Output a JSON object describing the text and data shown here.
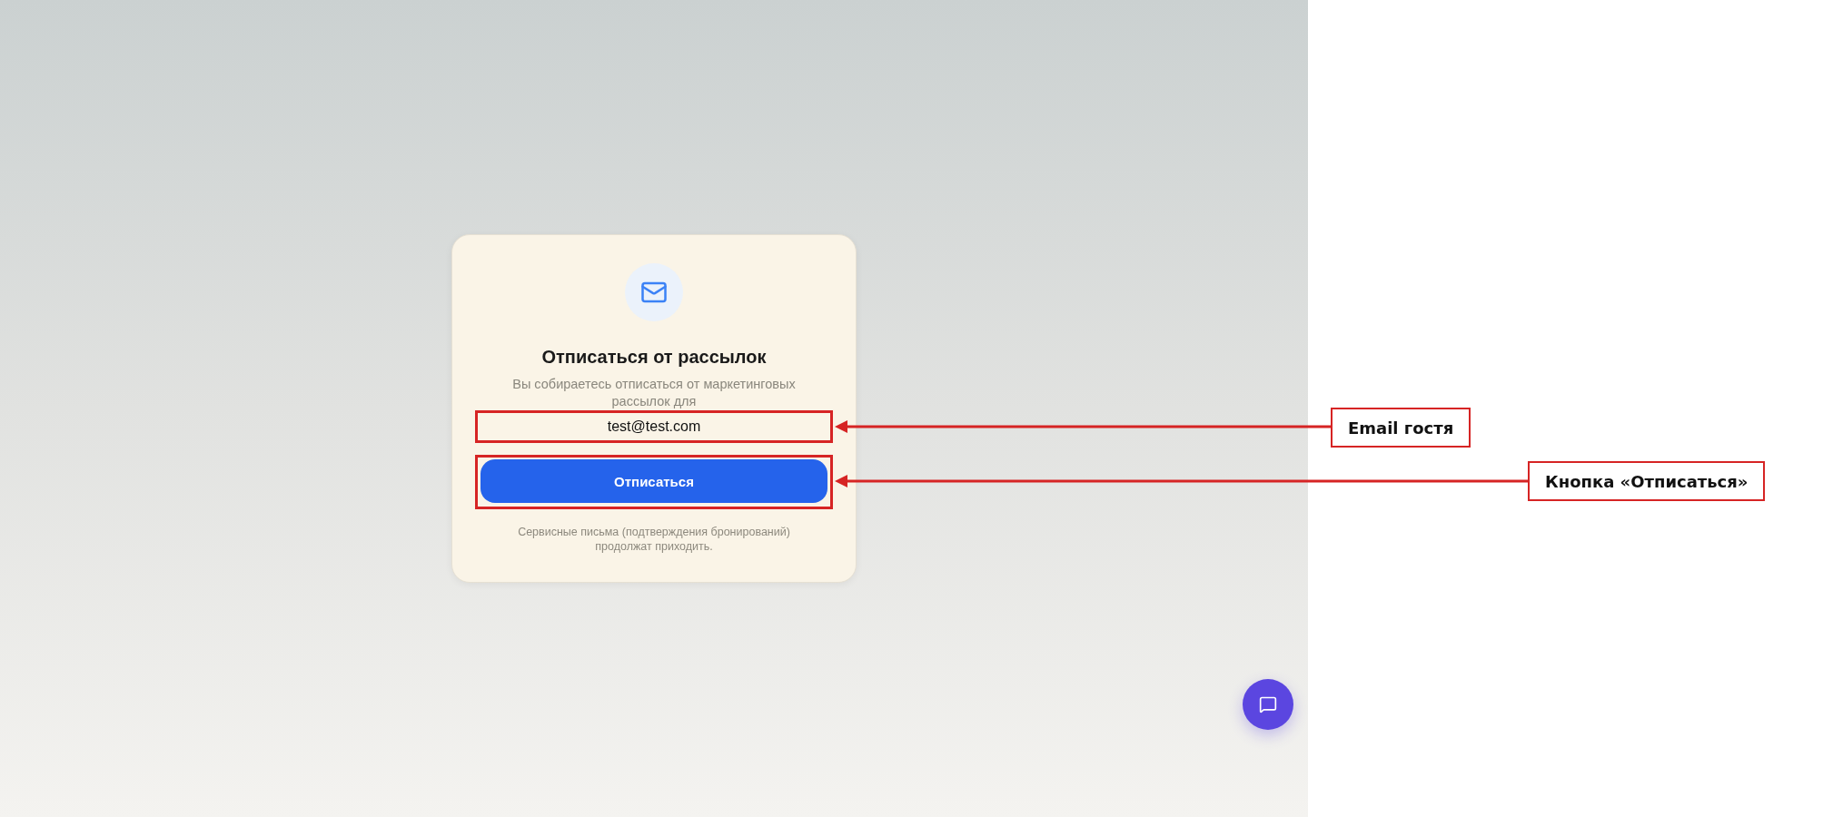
{
  "card": {
    "title": "Отписаться от рассылок",
    "description": "Вы собираетесь отписаться от маркетинговых рассылок для",
    "email": "test@test.com",
    "button": "Отписаться",
    "note": "Сервисные письма (подтверждения бронирований) продолжат приходить."
  },
  "annotations": [
    {
      "label": "Email гостя"
    },
    {
      "label": "Кнопка «Отписаться»"
    }
  ]
}
